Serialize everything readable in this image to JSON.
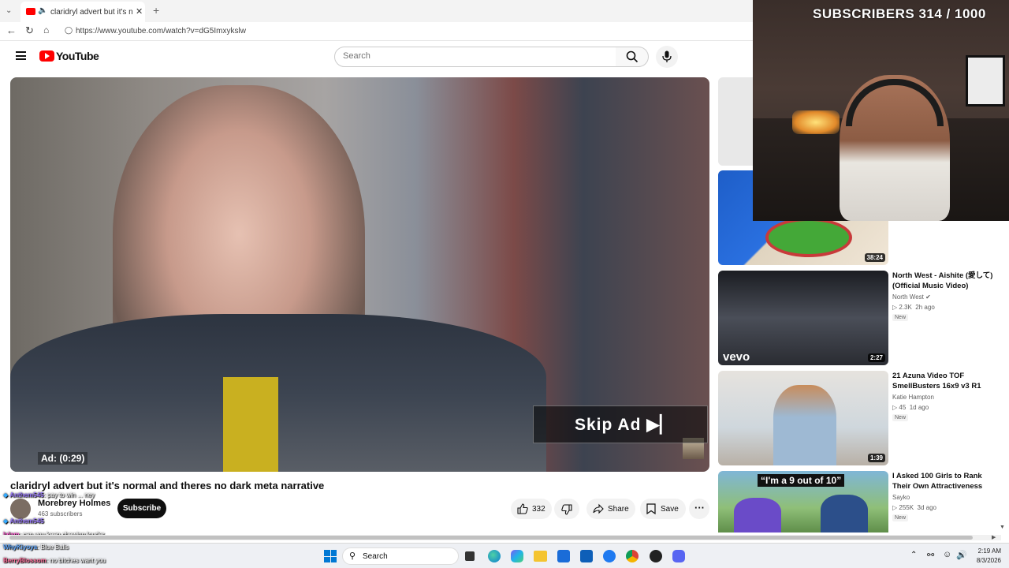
{
  "browser": {
    "tab_title": "claridryl advert but it's normal",
    "url": "https://www.youtube.com/watch?v=dG5Imxykslw"
  },
  "youtube": {
    "logo_text": "YouTube",
    "search_placeholder": "Search"
  },
  "video": {
    "skip_label": "Skip Ad ▶▏",
    "ad_timer": "Ad: (0:29)",
    "title": "claridryl advert but it's normal and theres no dark meta narrative",
    "channel": "Morebrey Holmes",
    "subscribers": "463 subscribers",
    "subscribe_label": "Subscribe",
    "likes": "332",
    "share_label": "Share",
    "save_label": "Save"
  },
  "recommendations": [
    {
      "duration": "38:24"
    },
    {
      "title": "North West - Aishite (愛して) (Official Music Video)",
      "channel": "North West",
      "views": "2.3K",
      "age": "2h ago",
      "badge": "New",
      "duration": "2:27",
      "thumb_text": "vevo"
    },
    {
      "title": "21 Azuna Video TOF SmellBusters 16x9 v3 R1",
      "channel": "Katie Hampton",
      "views": "45",
      "age": "1d ago",
      "badge": "New",
      "duration": "1:39"
    },
    {
      "title": "I Asked 100 Girls to Rank Their Own Attractiveness",
      "channel": "Sayko",
      "views": "255K",
      "age": "3d ago",
      "badge": "New",
      "thumb_text": "“I'm a 9 out of 10”"
    }
  ],
  "stream": {
    "subscriber_goal": "SUBSCRIBERS 314 / 1000"
  },
  "chat": [
    {
      "user": "Anthem545",
      "text": ": pay to win ... ney"
    },
    {
      "user": "Anthem545",
      "text": ""
    },
    {
      "user": "lalam",
      "text": ": can you keep chewing louder"
    },
    {
      "user": "WhyKiyoya",
      "text": ": Blue Balls"
    },
    {
      "user": "BerryBlossom",
      "text": ": no bitches want you"
    }
  ],
  "taskbar": {
    "search_label": "Search",
    "time": "2:19 AM",
    "date": "8/3/2026"
  },
  "icons": [
    "back-icon",
    "refresh-icon",
    "home-icon",
    "menu-icon",
    "search-icon",
    "mic-icon",
    "like-icon",
    "dislike-icon",
    "share-icon",
    "save-icon",
    "more-icon",
    "windows-icon"
  ]
}
